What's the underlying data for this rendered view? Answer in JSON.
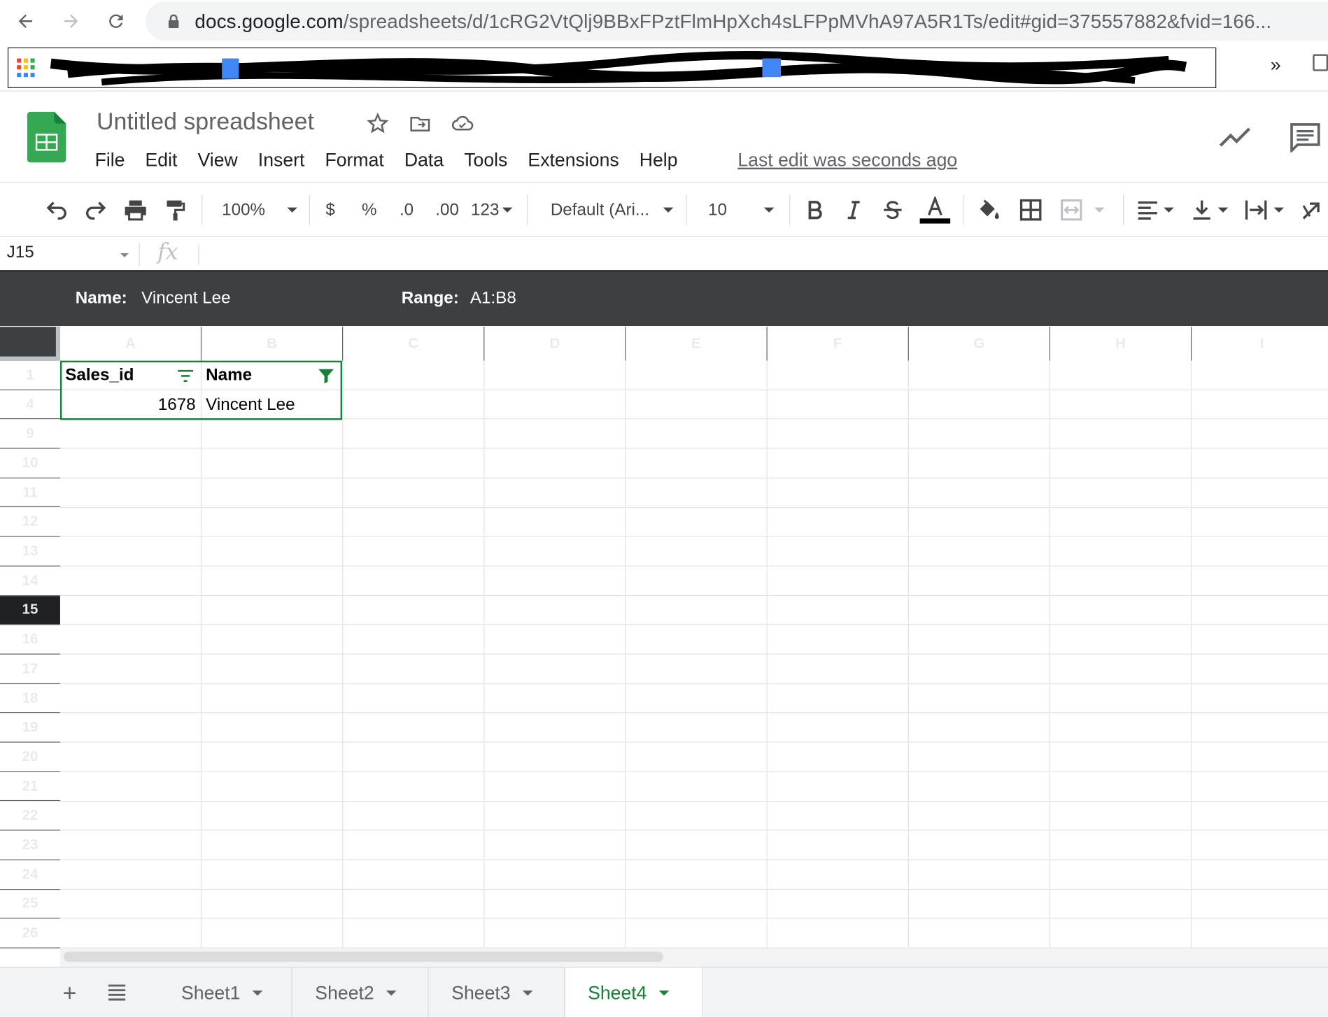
{
  "browser": {
    "url_host": "docs.google.com",
    "url_path": "/spreadsheets/d/1cRG2VtQlj9BBxFPztFlmHpXch4sLFPpMVhA97A5R1Ts/edit#gid=375557882&fvid=166...",
    "bookmarks_more": "»"
  },
  "header": {
    "title": "Untitled spreadsheet",
    "last_edit": "Last edit was seconds ago",
    "menu": [
      "File",
      "Edit",
      "View",
      "Insert",
      "Format",
      "Data",
      "Tools",
      "Extensions",
      "Help"
    ]
  },
  "toolbar": {
    "zoom": "100%",
    "currency": "$",
    "percent": "%",
    "decrease_decimal": ".0",
    "increase_decimal": ".00",
    "number_format": "123",
    "font": "Default (Ari...",
    "font_size": "10",
    "text_color": "#000000"
  },
  "formula_bar": {
    "cell_ref": "J15",
    "fx": "fx",
    "value": ""
  },
  "filter_view": {
    "name_label": "Name:",
    "name_value": "Vincent Lee",
    "range_label": "Range:",
    "range_value": "A1:B8",
    "accent": "#188038"
  },
  "grid": {
    "columns": [
      "A",
      "B",
      "C",
      "D",
      "E",
      "F",
      "G",
      "H",
      "I"
    ],
    "rows": [
      "1",
      "4",
      "9",
      "10",
      "11",
      "12",
      "13",
      "14",
      "15",
      "16",
      "17",
      "18",
      "19",
      "20",
      "21",
      "22",
      "23",
      "24",
      "25",
      "26"
    ],
    "active_row": "15",
    "cells": {
      "A1": "Sales_id",
      "B1": "Name",
      "A4": "1678",
      "B4": "Vincent Lee"
    }
  },
  "sheets": {
    "tabs": [
      "Sheet1",
      "Sheet2",
      "Sheet3",
      "Sheet4"
    ],
    "active": "Sheet4",
    "add": "+"
  }
}
